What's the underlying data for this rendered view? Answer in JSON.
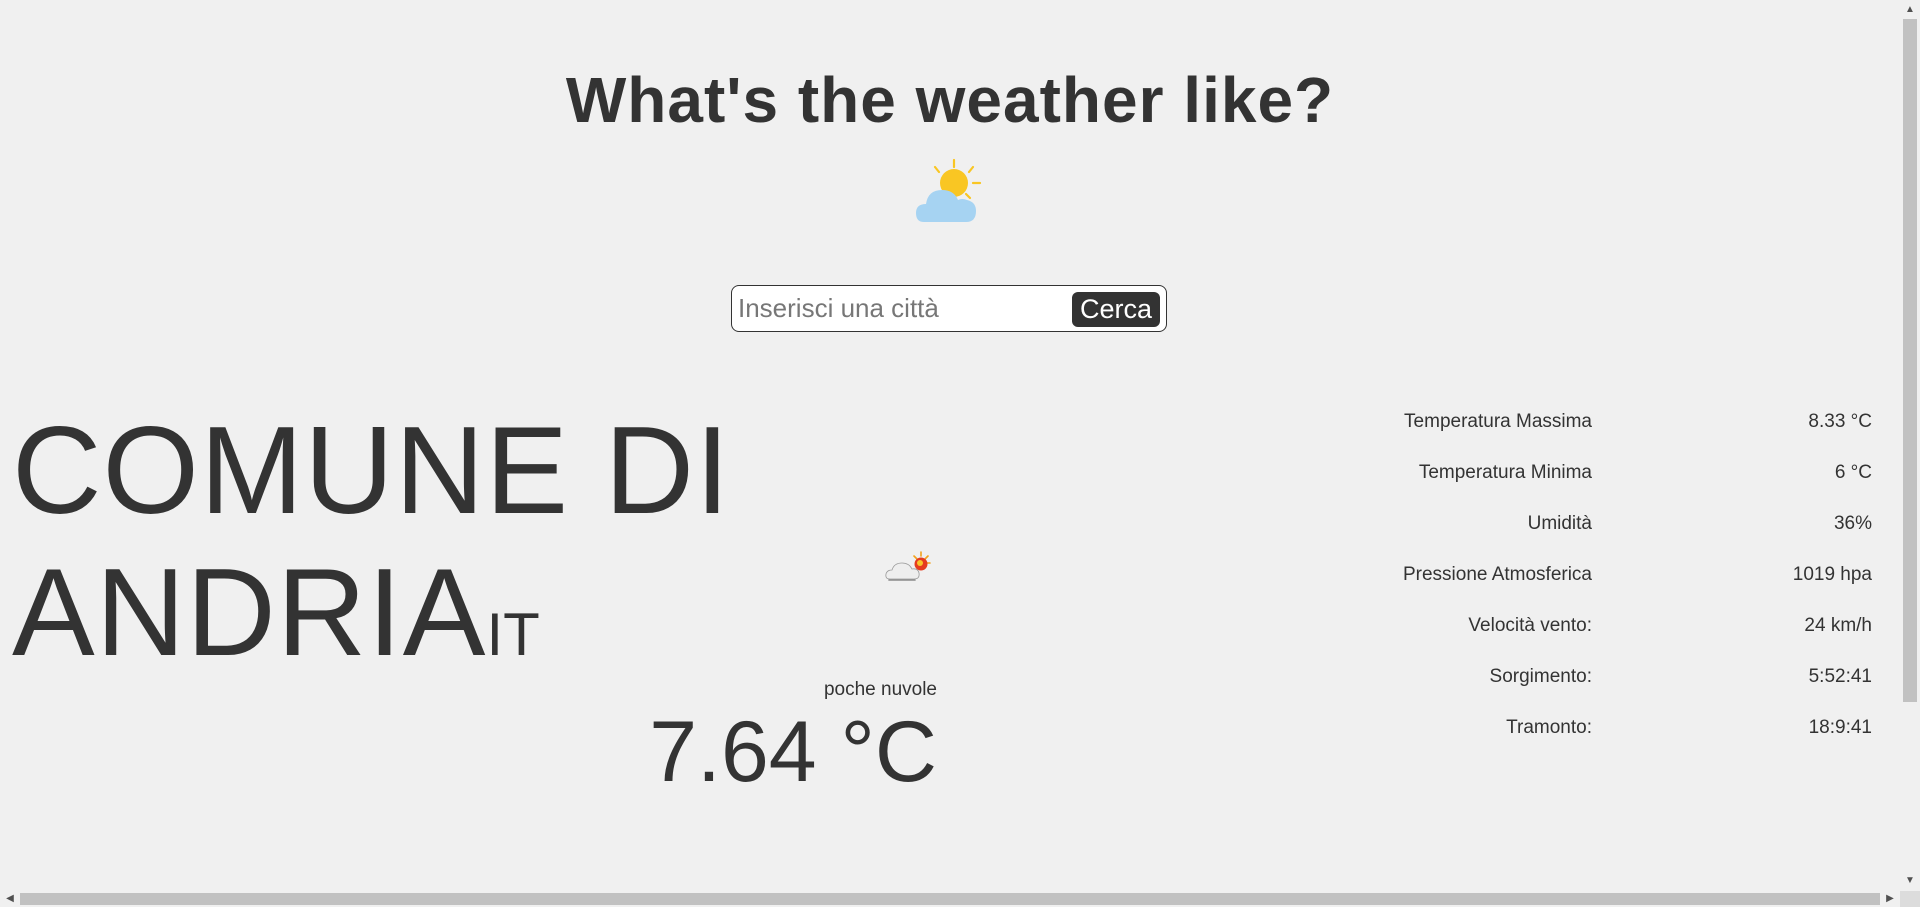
{
  "header": {
    "title": "What's the weather like?",
    "hero_icon": "sun-behind-cloud-icon"
  },
  "search": {
    "placeholder": "Inserisci una città",
    "value": "",
    "button_label": "Cerca"
  },
  "current": {
    "city_line1": "COMUNE DI",
    "city_line2": "ANDRIA",
    "country": "IT",
    "condition_icon": "few-clouds-icon",
    "description": "poche nuvole",
    "temperature": "7.64 °C"
  },
  "stats": [
    {
      "label": "Temperatura Massima",
      "value": "8.33 °C"
    },
    {
      "label": "Temperatura Minima",
      "value": "6 °C"
    },
    {
      "label": "Umidità",
      "value": "36%"
    },
    {
      "label": "Pressione Atmosferica",
      "value": "1019 hpa"
    },
    {
      "label": "Velocità vento:",
      "value": "24 km/h"
    },
    {
      "label": "Sorgimento:",
      "value": "5:52:41"
    },
    {
      "label": "Tramonto:",
      "value": "18:9:41"
    }
  ],
  "colors": {
    "background": "#f0f0f0",
    "text": "#333333",
    "button_bg": "#333333",
    "button_text": "#ffffff",
    "sun": "#f9c623",
    "cloud": "#a6d3f2"
  }
}
